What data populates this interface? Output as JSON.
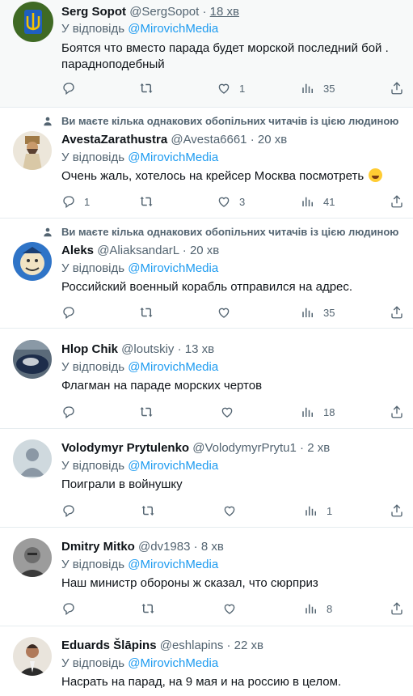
{
  "replies": [
    {
      "name": "Serg Sopot",
      "handle": "@SergSopot",
      "time": "18 хв",
      "reply_prefix": "У відповідь",
      "reply_to": "@MirovichMedia",
      "text": "Боятся что вместо парада будет морской последний бой . парадноподебный",
      "counts": {
        "reply": "",
        "retweet": "",
        "like": "1",
        "views": "35"
      }
    },
    {
      "social_context": "Ви маєте кілька однакових обопільних читачів із цією людиною",
      "name": "AvestaZarathustra",
      "handle": "@Avesta6661",
      "time": "20 хв",
      "reply_prefix": "У відповідь",
      "reply_to": "@MirovichMedia",
      "text": "Очень жаль, хотелось на крейсер Москва посмотреть",
      "counts": {
        "reply": "1",
        "retweet": "",
        "like": "3",
        "views": "41"
      }
    },
    {
      "social_context": "Ви маєте кілька однакових обопільних читачів із цією людиною",
      "name": "Aleks",
      "handle": "@AliaksandarL",
      "time": "20 хв",
      "reply_prefix": "У відповідь",
      "reply_to": "@MirovichMedia",
      "text": "Российский военный корабль отправился на адрес.",
      "counts": {
        "reply": "",
        "retweet": "",
        "like": "",
        "views": "35"
      }
    },
    {
      "name": "Hlop Chik",
      "handle": "@loutskiy",
      "time": "13 хв",
      "reply_prefix": "У відповідь",
      "reply_to": "@MirovichMedia",
      "text": "Флагман на параде морских чертов",
      "counts": {
        "reply": "",
        "retweet": "",
        "like": "",
        "views": "18"
      }
    },
    {
      "name": "Volodymyr Prytulenko",
      "handle": "@VolodymyrPrytu1",
      "time": "2 хв",
      "reply_prefix": "У відповідь",
      "reply_to": "@MirovichMedia",
      "text": "Поиграли в войнушку",
      "counts": {
        "reply": "",
        "retweet": "",
        "like": "",
        "views": "1"
      }
    },
    {
      "name": "Dmitry Mitko",
      "handle": "@dv1983",
      "time": "8 хв",
      "reply_prefix": "У відповідь",
      "reply_to": "@MirovichMedia",
      "text": "Наш министр обороны ж сказал, что сюрприз",
      "counts": {
        "reply": "",
        "retweet": "",
        "like": "",
        "views": "8"
      }
    },
    {
      "name": "Eduards Šlāpins",
      "handle": "@eshlapins",
      "time": "22 хв",
      "reply_prefix": "У відповідь",
      "reply_to": "@MirovichMedia",
      "text": "Насрать на парад, на 9 мая и на россию в целом.",
      "counts": {
        "reply": "",
        "retweet": "",
        "like": "",
        "views": ""
      }
    }
  ],
  "colors": {
    "accent": "#1d9bf0",
    "secondary_text": "#536471",
    "divider": "#e6ecf0"
  },
  "icons": [
    "reply-icon",
    "retweet-icon",
    "like-icon",
    "views-icon",
    "share-icon",
    "person-icon",
    "laughing-emoji-icon"
  ]
}
